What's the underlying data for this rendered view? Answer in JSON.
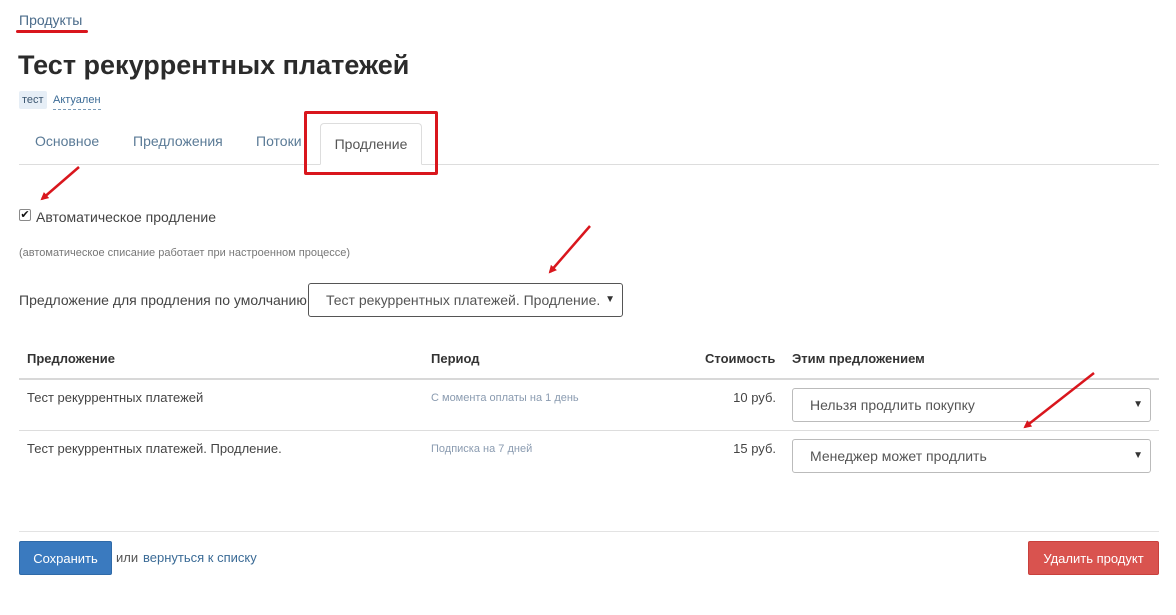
{
  "breadcrumb": {
    "label": "Продукты"
  },
  "product": {
    "title": "Тест рекуррентных платежей",
    "tag": "тест",
    "status": "Актуален"
  },
  "tabs": [
    {
      "label": "Основное"
    },
    {
      "label": "Предложения"
    },
    {
      "label": "Потоки"
    },
    {
      "label": "Продление"
    }
  ],
  "renewal": {
    "auto_label": "Автоматическое продление",
    "auto_checked": true,
    "hint": "(автоматическое списание работает при настроенном процессе)",
    "default_label": "Предложение для продления по умолчанию:",
    "default_value": "Тест рекуррентных платежей. Продление."
  },
  "table": {
    "headers": [
      "Предложение",
      "Период",
      "Стоимость",
      "Этим предложением"
    ],
    "rows": [
      {
        "offer": "Тест рекуррентных платежей",
        "period": "С момента оплаты на 1 день",
        "price": "10 руб.",
        "action": "Нельзя продлить покупку"
      },
      {
        "offer": "Тест рекуррентных платежей. Продление.",
        "period": "Подписка на 7 дней",
        "price": "15 руб.",
        "action": "Менеджер может продлить"
      }
    ]
  },
  "footer": {
    "save_label": "Сохранить",
    "or_text": "или",
    "back_label": "вернуться к списку",
    "delete_label": "Удалить продукт"
  },
  "colors": {
    "annotation_red": "#d9161d",
    "primary_button": "#3a7abf",
    "danger_button": "#d9534f"
  },
  "icons": {
    "select_caret": "caret-down-icon",
    "checkbox": "check-icon",
    "annotation": "red-arrow-icon"
  }
}
